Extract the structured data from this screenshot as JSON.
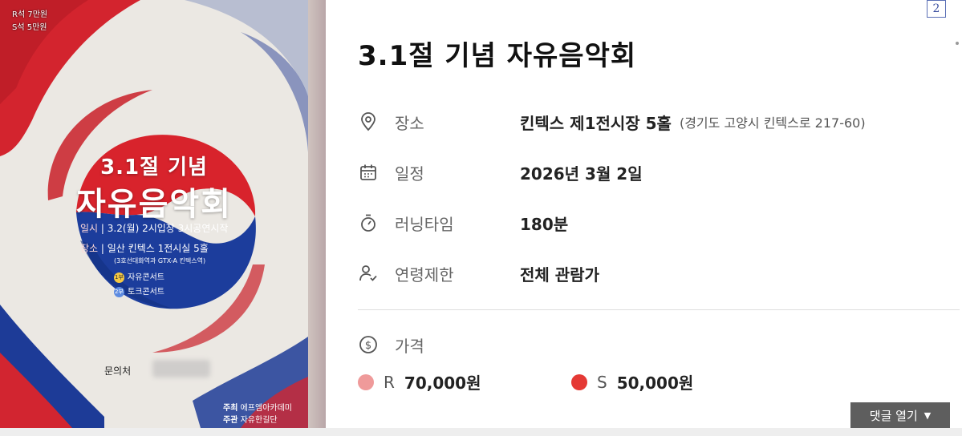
{
  "poster": {
    "seat_r": "R석 7만원",
    "seat_s": "S석 5만원",
    "title_line1": "3.1절 기념",
    "title_line2": "자유음악회",
    "date_key": "일시",
    "date_value": "3.2(월) 2시입장 3시공연시작",
    "venue_key": "장소",
    "venue_value": "일산 킨텍스 1전시실 5홀",
    "venue_note": "(3호선대화역과 GTX-A 킨텍스역)",
    "program1_badge": "1부",
    "program1": "자유콘서트",
    "program2_badge": "2부",
    "program2": "토크콘서트",
    "contact_label": "문의처",
    "host_label": "주최",
    "host_value": "에프엠아카데미",
    "organizer_label": "주관",
    "organizer_value": "자유한길단"
  },
  "page_number": "2",
  "title": "3.1절 기념 자유음악회",
  "details": [
    {
      "icon": "location-pin-icon",
      "label": "장소",
      "value": "킨텍스 제1전시장 5홀",
      "sub": "(경기도 고양시 킨텍스로 217-60)"
    },
    {
      "icon": "calendar-icon",
      "label": "일정",
      "value": "2026년 3월 2일"
    },
    {
      "icon": "stopwatch-icon",
      "label": "러닝타임",
      "value": "180분"
    },
    {
      "icon": "user-check-icon",
      "label": "연령제한",
      "value": "전체 관람가"
    }
  ],
  "price": {
    "icon": "dollar-circle-icon",
    "label": "가격",
    "items": [
      {
        "seat": "R",
        "value": "70,000원",
        "color": "#ef9a9a"
      },
      {
        "seat": "S",
        "value": "50,000원",
        "color": "#e53935"
      }
    ]
  },
  "comment_button": {
    "label": "댓글 열기",
    "icon": "caret-down-icon"
  }
}
